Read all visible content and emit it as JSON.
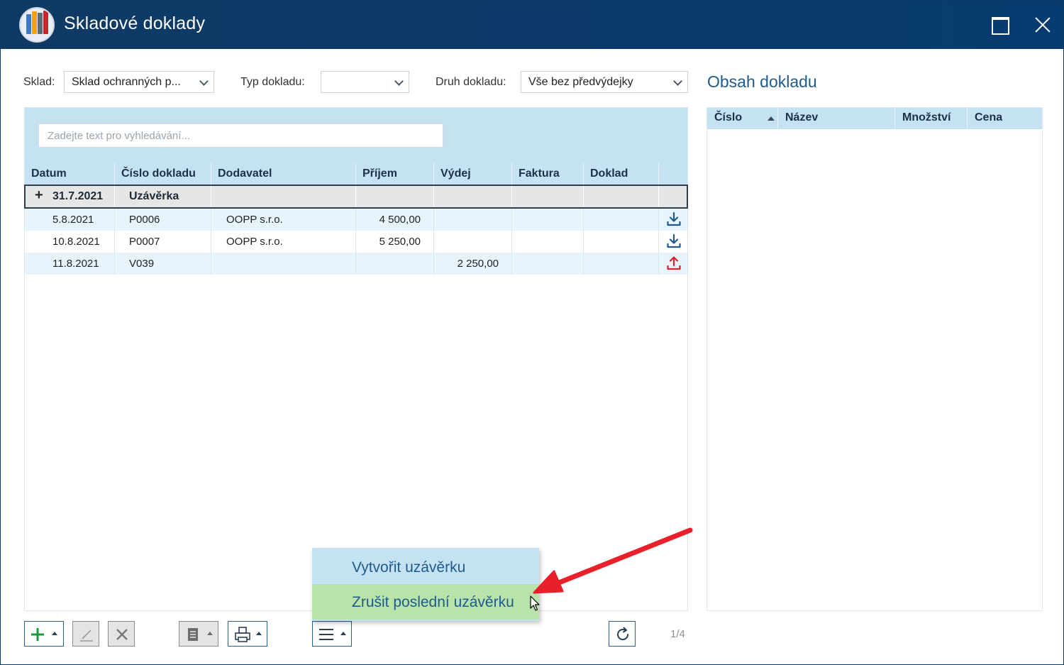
{
  "window": {
    "title": "Skladové doklady"
  },
  "filters": {
    "sklad_label": "Sklad:",
    "sklad_value": "Sklad ochranných p...",
    "typ_label": "Typ dokladu:",
    "typ_value": "",
    "druh_label": "Druh dokladu:",
    "druh_value": "Vše bez předvýdejky"
  },
  "search": {
    "placeholder": "Zadejte text pro vyhledávání..."
  },
  "grid": {
    "columns": [
      "Datum",
      "Číslo dokladu",
      "Dodavatel",
      "Příjem",
      "Výdej",
      "Faktura",
      "Doklad"
    ],
    "group": {
      "date": "31.7.2021",
      "label": "Uzávěrka"
    },
    "rows": [
      {
        "datum": "5.8.2021",
        "cislo": "P0006",
        "dodavatel": "OOPP s.r.o.",
        "prijem": "4 500,00",
        "vydej": "",
        "icon": "download-icon"
      },
      {
        "datum": "10.8.2021",
        "cislo": "P0007",
        "dodavatel": "OOPP s.r.o.",
        "prijem": "5 250,00",
        "vydej": "",
        "icon": "download-icon"
      },
      {
        "datum": "11.8.2021",
        "cislo": "V039",
        "dodavatel": "",
        "prijem": "",
        "vydej": "2 250,00",
        "icon": "upload-icon"
      }
    ]
  },
  "detail": {
    "title": "Obsah dokladu",
    "columns": [
      "Číslo",
      "Název",
      "Množství",
      "Cena"
    ]
  },
  "menu": {
    "items": [
      "Vytvořit uzávěrku",
      "Zrušit poslední uzávěrku"
    ]
  },
  "toolbar": {
    "page_info": "1/4"
  },
  "colors": {
    "titlebar": "#0b3a6a",
    "accent": "#1e5a8c",
    "header_bg": "#c5e2f3",
    "menu_hover": "#b9e4a9",
    "download": "#1e5a8c",
    "upload": "#d9232e",
    "arrow": "#e8202a"
  }
}
